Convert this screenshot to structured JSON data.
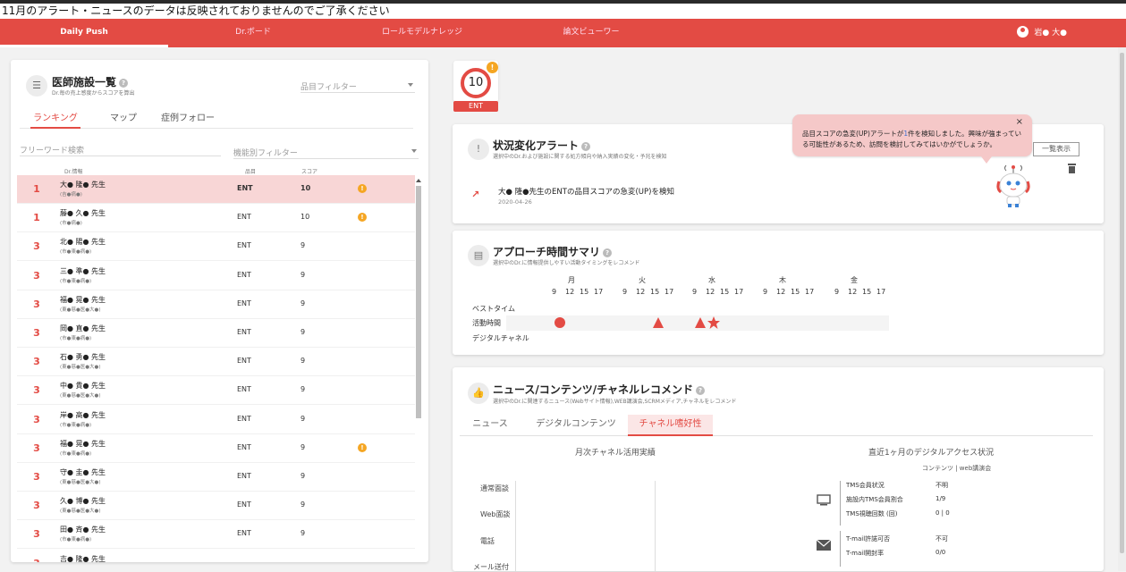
{
  "notice": "11月のアラート・ニュースのデータは反映されておりませんのでご了承ください",
  "nav": {
    "items": [
      {
        "label": "Daily Push"
      },
      {
        "label": "Dr.ボード"
      },
      {
        "label": "ロールモデルナレッジ"
      },
      {
        "label": "論文ビューワー"
      }
    ],
    "user_name": "岩● 大●"
  },
  "left_panel": {
    "title": "医師施設一覧",
    "help": "?",
    "subtitle": "Dr.毎の売上感度からスコアを算出",
    "product_filter": "品目フィルター",
    "tabs": [
      {
        "label": "ランキング"
      },
      {
        "label": "マップ"
      },
      {
        "label": "症例フォロー"
      }
    ],
    "search_placeholder": "フリーワード検索",
    "function_filter": "機能別フィルター",
    "columns": {
      "doctor": "Dr.情報",
      "product": "品目",
      "score": "スコア"
    },
    "rows": [
      {
        "rank": "1",
        "name": "大● 隆● 先生",
        "sub": "(吉●病●)",
        "product": "ENT",
        "score": "10",
        "alert": "!",
        "highlight": true
      },
      {
        "rank": "1",
        "name": "藤● 久● 先生",
        "sub": "(市●病●)",
        "product": "ENT",
        "score": "10",
        "alert": "!"
      },
      {
        "rank": "3",
        "name": "北● 陽● 先生",
        "sub": "(市●東●病●)",
        "product": "ENT",
        "score": "9"
      },
      {
        "rank": "3",
        "name": "三● 準● 先生",
        "sub": "(市●東●病●)",
        "product": "ENT",
        "score": "9"
      },
      {
        "rank": "3",
        "name": "福● 晃● 先生",
        "sub": "(東●慈●医●大●)",
        "product": "ENT",
        "score": "9"
      },
      {
        "rank": "3",
        "name": "岡● 直● 先生",
        "sub": "(市●東●病●)",
        "product": "ENT",
        "score": "9"
      },
      {
        "rank": "3",
        "name": "石● 勇● 先生",
        "sub": "(東●慈●医●大●)",
        "product": "ENT",
        "score": "9"
      },
      {
        "rank": "3",
        "name": "中● 貴● 先生",
        "sub": "(東●慈●医●大●)",
        "product": "ENT",
        "score": "9"
      },
      {
        "rank": "3",
        "name": "岸● 高● 先生",
        "sub": "(市●東●病●)",
        "product": "ENT",
        "score": "9"
      },
      {
        "rank": "3",
        "name": "福● 晃● 先生",
        "sub": "(市●東●病●)",
        "product": "ENT",
        "score": "9",
        "alert": "!"
      },
      {
        "rank": "3",
        "name": "守● 圭● 先生",
        "sub": "(東●慈●医●大●)",
        "product": "ENT",
        "score": "9"
      },
      {
        "rank": "3",
        "name": "久● 博● 先生",
        "sub": "(東●慈●医●大●)",
        "product": "ENT",
        "score": "9"
      },
      {
        "rank": "3",
        "name": "田● 斉● 先生",
        "sub": "(市●東●病●)",
        "product": "ENT",
        "score": "9"
      },
      {
        "rank": "3",
        "name": "吉● 隆● 先生",
        "sub": "",
        "product": "",
        "score": ""
      }
    ]
  },
  "product_badge": {
    "score": "10",
    "alert": "!",
    "label": "ENT"
  },
  "alert_card": {
    "title": "状況変化アラート",
    "help": "?",
    "subtitle": "選択中のDr.および施設に関する処方傾向や納入実績の変化・予兆を検知",
    "item_text": "大● 隆●先生のENTの品目スコアの急変(UP)を検知",
    "item_date": "2020-04-26",
    "list_button": "一覧表示"
  },
  "balloon": {
    "close": "×",
    "text_before": "品目スコアの急変(UP)アラートが",
    "count": "1",
    "text_after": "件を検知しました。興味が強まっている可能性があるため、訪問を検討してみてはいかがでしょうか。"
  },
  "approach_card": {
    "title": "アプローチ時間サマリ",
    "help": "?",
    "subtitle": "選択中のDr.に情報提供しやすい活動タイミングをレコメンド",
    "days": [
      "月",
      "火",
      "水",
      "木",
      "金"
    ],
    "hours": [
      "9",
      "12",
      "15",
      "17"
    ],
    "row_labels": [
      "ベストタイム",
      "活動時間",
      "デジタルチャネル"
    ],
    "marks": [
      {
        "day": "月",
        "hour": "9",
        "shape": "circle"
      },
      {
        "day": "火",
        "hour": "15",
        "shape": "triangle"
      },
      {
        "day": "水",
        "hour": "9",
        "shape": "triangle"
      },
      {
        "day": "水",
        "hour": "12",
        "shape": "star"
      }
    ],
    "accent": "#e34b44"
  },
  "news_card": {
    "title": "ニュース/コンテンツ/チャネルレコメンド",
    "help": "?",
    "subtitle": "選択中のDr.に関連するニュース(Webサイト情報),WEB講演会,SCRMメディア,チャネルをレコメンド",
    "tabs": [
      {
        "label": "ニュース"
      },
      {
        "label": "デジタルコンテンツ"
      },
      {
        "label": "チャネル嗜好性"
      }
    ],
    "monthly_title": "月次チャネル活用実績",
    "channels": [
      "通常面談",
      "Web面談",
      "電話",
      "メール送付"
    ],
    "access_title": "直近1ヶ月のデジタルアクセス状況",
    "access_sub": "コンテンツ | web講演会",
    "tms": [
      {
        "label": "TMS会員状況",
        "value": "不明"
      },
      {
        "label": "施設内TMS会員割合",
        "value": "1/9"
      },
      {
        "label": "TMS視聴回数 (回)",
        "value": "0 | 0"
      }
    ],
    "tmail": [
      {
        "label": "T-mail許諾可否",
        "value": "不可"
      },
      {
        "label": "T-mail開封率",
        "value": "0/0"
      }
    ]
  }
}
